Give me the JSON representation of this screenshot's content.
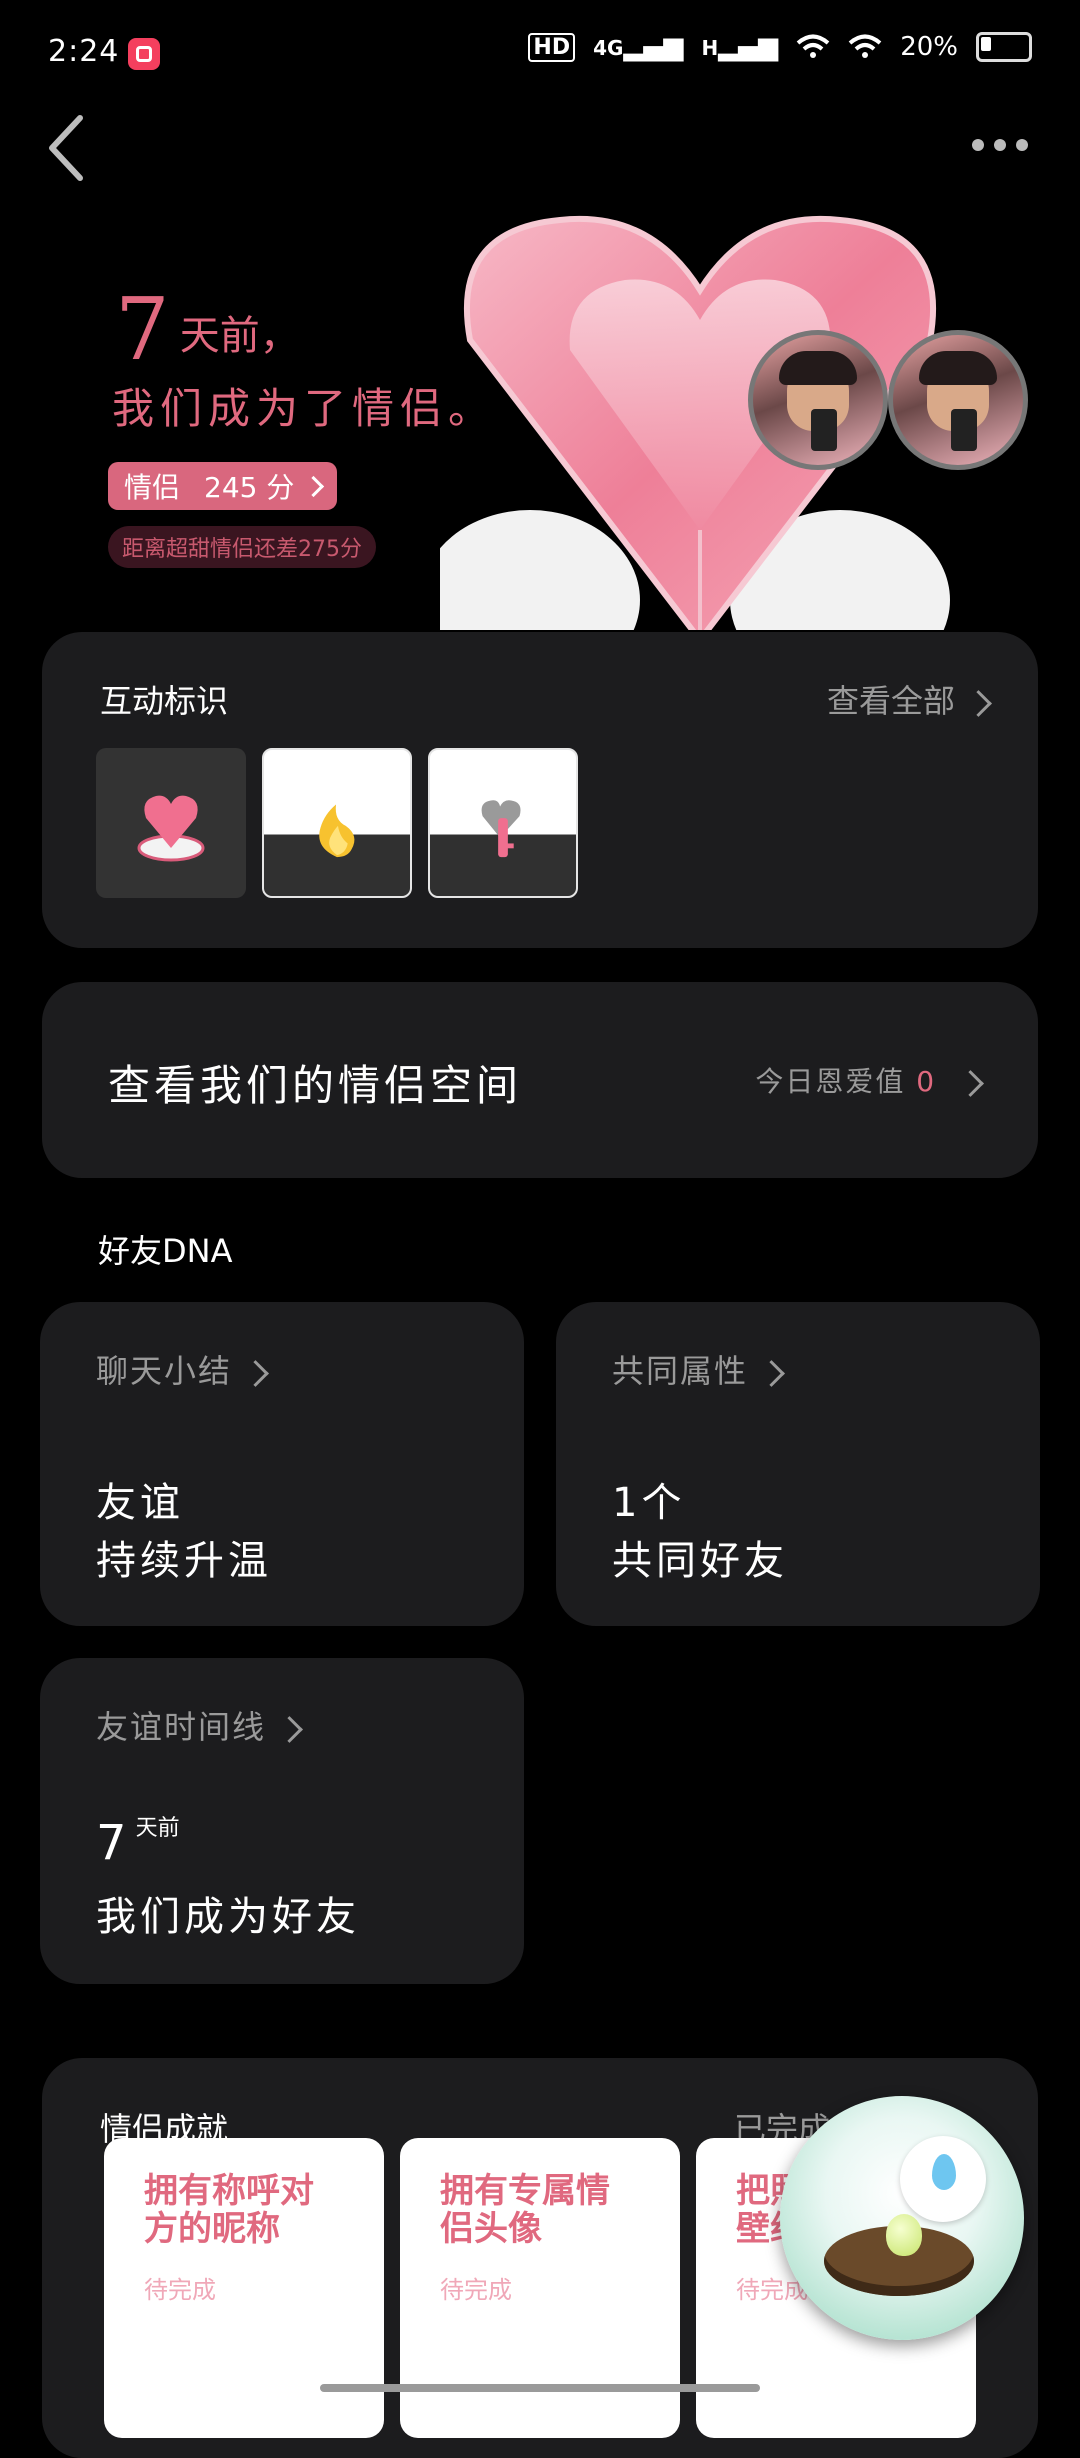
{
  "status": {
    "time": "2:24",
    "net1": "HD",
    "net2": "4G",
    "net3": "H",
    "battery": "20%"
  },
  "hero": {
    "days_number": "7",
    "days_suffix": "天前，",
    "line2": "我们成为了情侣。",
    "score_label": "情侣",
    "score_value": "245 分",
    "hint": "距离超甜情侣还差275分"
  },
  "interaction": {
    "title": "互动标识",
    "view_all": "查看全部"
  },
  "couple_space": {
    "title": "查看我们的情侣空间",
    "love_label": "今日恩爱值",
    "love_value": "0"
  },
  "friend_dna": {
    "label": "好友DNA",
    "chat": {
      "head": "聊天小结",
      "line1": "友谊",
      "line2": "持续升温"
    },
    "common": {
      "head": "共同属性",
      "line1": "1个",
      "line2": "共同好友"
    },
    "timeline": {
      "head": "友谊时间线",
      "num": "7",
      "unit": "天前",
      "line2": "我们成为好友"
    }
  },
  "achievements": {
    "title": "情侣成就",
    "right": "已完成",
    "cards": [
      {
        "title": "拥有称呼对方的昵称",
        "status": "待完成"
      },
      {
        "title": "拥有专属情侣头像",
        "status": "待完成"
      },
      {
        "title": "把照片设为壁纸",
        "status": "待完成"
      }
    ]
  },
  "colors": {
    "accent": "#e0697f",
    "card_bg": "#1c1c1e"
  }
}
